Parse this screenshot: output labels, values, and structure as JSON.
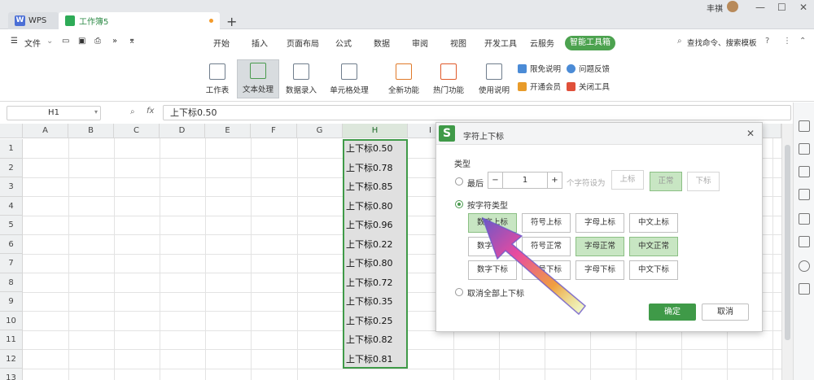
{
  "titlebar": {
    "wps_tab": "WPS",
    "wps_logo": "W",
    "doc_tab": "工作簿5",
    "plus": "+",
    "user": "丰祺"
  },
  "menu": {
    "file": "文件",
    "items": [
      "开始",
      "插入",
      "页面布局",
      "公式",
      "数据",
      "审阅",
      "视图",
      "开发工具",
      "云服务"
    ],
    "smart": "智能工具箱",
    "search": "查找命令、搜索模板"
  },
  "ribbon": {
    "buttons": [
      "工作表",
      "文本处理",
      "数据录入",
      "单元格处理",
      "全新功能",
      "热门功能",
      "使用说明"
    ],
    "links": [
      "限免说明",
      "问题反馈",
      "开通会员",
      "关闭工具"
    ]
  },
  "formula": {
    "cell_ref": "H1",
    "fx": "fx",
    "value": "上下标0.50"
  },
  "sheet": {
    "columns": [
      "A",
      "B",
      "C",
      "D",
      "E",
      "F",
      "G",
      "H",
      "I"
    ],
    "rows": [
      "1",
      "2",
      "3",
      "4",
      "5",
      "6",
      "7",
      "8",
      "9",
      "10",
      "11",
      "12",
      "13"
    ],
    "h_values": [
      "上下标0.50",
      "上下标0.78",
      "上下标0.85",
      "上下标0.80",
      "上下标0.96",
      "上下标0.22",
      "上下标0.80",
      "上下标0.72",
      "上下标0.35",
      "上下标0.25",
      "上下标0.82",
      "上下标0.81"
    ]
  },
  "dialog": {
    "logo": "S",
    "title": "字符上下标",
    "type_label": "类型",
    "last_label": "最后",
    "stepper_value": "1",
    "stepper_minus": "−",
    "stepper_plus": "+",
    "set_as": "个字符设为",
    "btn_sup": "上标",
    "btn_normal": "正常",
    "btn_sub": "下标",
    "by_type_label": "按字符类型",
    "grid": [
      [
        "数字上标",
        "符号上标",
        "字母上标",
        "中文上标"
      ],
      [
        "数字正常",
        "符号正常",
        "字母正常",
        "中文正常"
      ],
      [
        "数字下标",
        "符号下标",
        "字母下标",
        "中文下标"
      ]
    ],
    "cancel_all": "取消全部上下标",
    "ok": "确定",
    "cancel": "取消"
  }
}
